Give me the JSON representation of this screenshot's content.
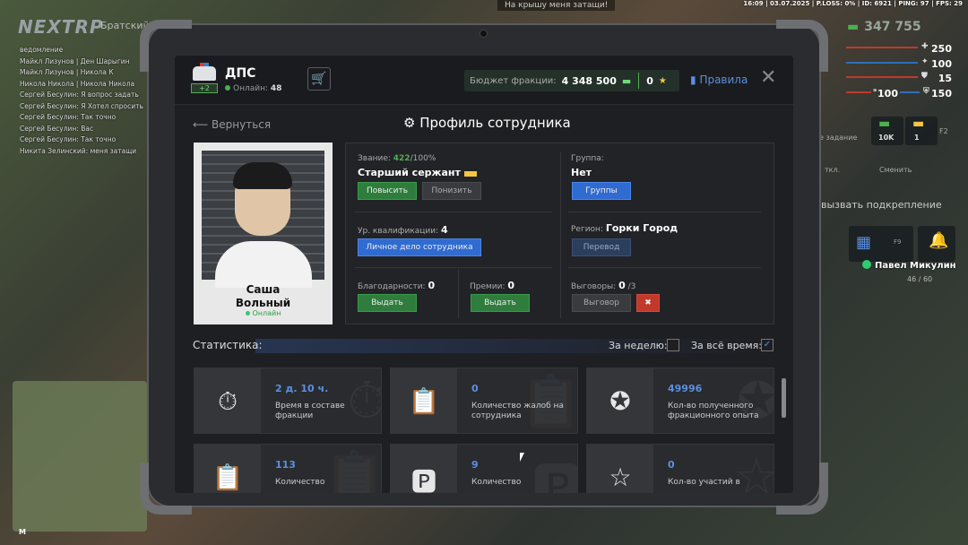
{
  "hud": {
    "top_info": "16:09 | 03.07.2025 | P.LOSS: 0% | ID: 6921 | PING: 97 | FPS: 29",
    "notice": "На крышу меня затащи!",
    "logo": "NEXTRP",
    "logo_sub": "Братский",
    "money": "347 755",
    "stats": [
      {
        "icon": "heart-icon",
        "value": "250",
        "color": "#c0392b"
      },
      {
        "icon": "food-icon",
        "value": "100",
        "color": "#2f6fb7"
      },
      {
        "icon": "armor-icon",
        "value": "15",
        "color": "#c0392b"
      },
      {
        "icon": "shield-icon",
        "value": "150",
        "color": "#2f6fb7"
      },
      {
        "icon": "bullet-icon",
        "value": "100",
        "color": "#c0392b"
      }
    ],
    "side": {
      "task": "е задание",
      "reward1": "10K",
      "reward2": "1",
      "key_f2": "F2",
      "skill": "ткл.",
      "change": "Сменить",
      "backup": "вызвать подкрепление",
      "key_f9": "F9"
    },
    "player_name": "Павел Микулин",
    "player_hp": "46 / 60",
    "minimap_letter": "M",
    "chat": [
      "ведомление",
      "Майкл Лизунов | Ден Шарыгин",
      "Майкл Лизунов | Никола К",
      "Никола Никола | Никола Никола",
      "Сергей Бесулин: Я вопрос задать",
      "Сергей Бесулин: Я Хотел спросить",
      "Сергей Бесулин: Так точно",
      "Сергей Бесулин: Вас",
      "Сергей Бесулин: Так точно",
      "Никита Зелинский: меня затащи"
    ]
  },
  "header": {
    "faction": "ДПС",
    "plus_badge": "+2",
    "online_label": "Онлайн:",
    "online_count": "48",
    "budget_label": "Бюджет фракции:",
    "budget_value": "4 348 500",
    "stars_value": "0",
    "rules": "Правила"
  },
  "page": {
    "back": "Вернуться",
    "title": "Профиль сотрудника"
  },
  "employee": {
    "first_name": "Саша",
    "last_name": "Вольный",
    "status": "Онлайн"
  },
  "profile": {
    "rank_label": "Звание:",
    "rank_points": "422",
    "rank_max": "/100%",
    "rank_name": "Старший сержант",
    "promote": "Повысить",
    "demote": "Понизить",
    "group_label": "Группа:",
    "group_value": "Нет",
    "groups_btn": "Группы",
    "qual_label": "Ур. квалификации:",
    "qual_value": "4",
    "case_btn": "Личное дело сотрудника",
    "region_label": "Регион:",
    "region_value": "Горки Город",
    "transfer_btn": "Перевод",
    "thanks_label": "Благодарности:",
    "thanks_value": "0",
    "thanks_btn": "Выдать",
    "bonus_label": "Премии:",
    "bonus_value": "0",
    "bonus_btn": "Выдать",
    "reprimand_label": "Выговоры:",
    "reprimand_value": "0",
    "reprimand_max": "/3",
    "reprimand_btn": "Выговор"
  },
  "statistics": {
    "title": "Статистика:",
    "week": "За неделю:",
    "all_time": "За всё время:",
    "week_checked": false,
    "all_checked": true,
    "cards": [
      {
        "icon": "stopwatch-icon",
        "glyph": "⏱",
        "value": "2 д. 10 ч.",
        "desc": "Время в составе фракции"
      },
      {
        "icon": "complaint-icon",
        "glyph": "📋",
        "value": "0",
        "desc": "Количество жалоб на сотрудника"
      },
      {
        "icon": "exp-icon",
        "glyph": "✪",
        "value": "49996",
        "desc": "Кол-во полученного фракционного опыта"
      },
      {
        "icon": "clipboard-icon",
        "glyph": "📋",
        "value": "113",
        "desc": "Количество"
      },
      {
        "icon": "fine-icon",
        "glyph": "🅿",
        "value": "9",
        "desc": "Количество"
      },
      {
        "icon": "star-icon",
        "glyph": "☆",
        "value": "0",
        "desc": "Кол-во участий в"
      }
    ]
  }
}
